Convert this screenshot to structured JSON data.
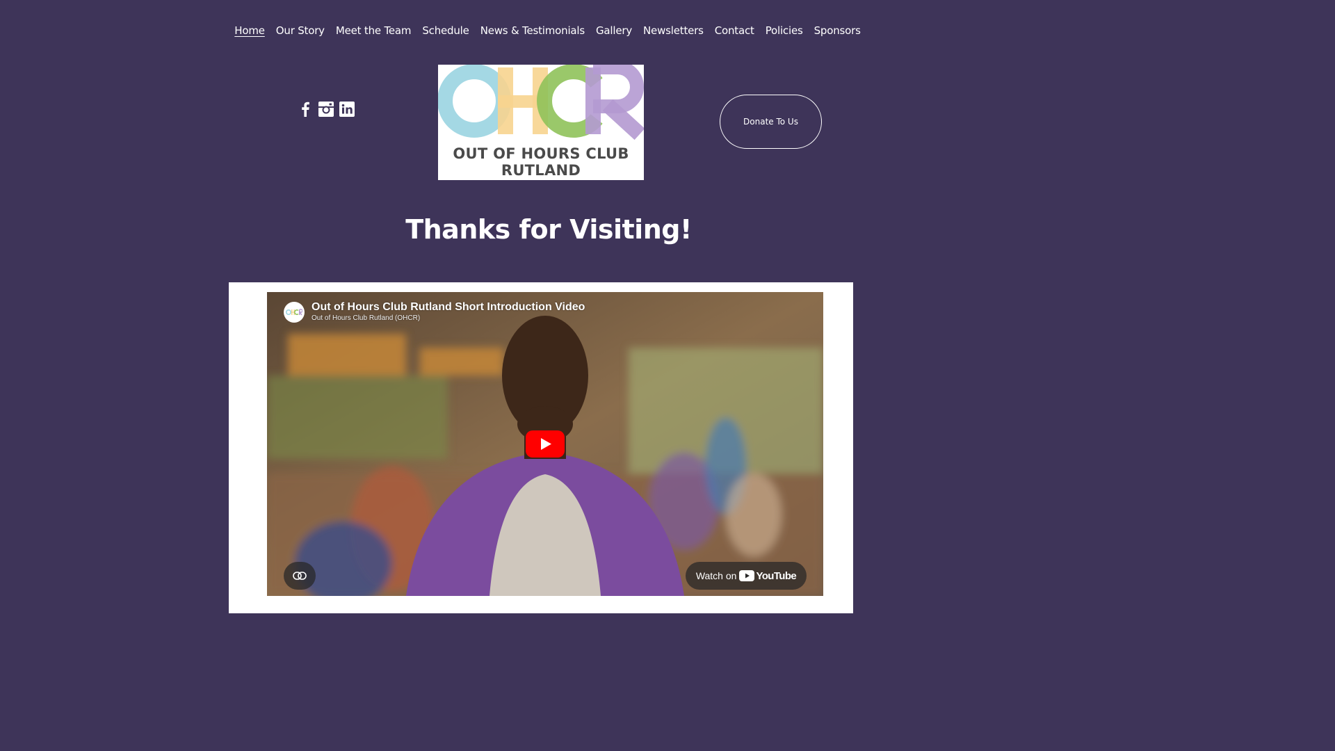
{
  "nav": {
    "items": [
      {
        "label": "Home",
        "active": true
      },
      {
        "label": "Our Story"
      },
      {
        "label": "Meet the Team"
      },
      {
        "label": "Schedule"
      },
      {
        "label": "News & Testimonials"
      },
      {
        "label": "Gallery"
      },
      {
        "label": "Newsletters"
      },
      {
        "label": "Contact"
      },
      {
        "label": "Policies"
      },
      {
        "label": "Sponsors"
      }
    ]
  },
  "social": {
    "icons": [
      "facebook-icon",
      "instagram-icon",
      "linkedin-icon"
    ]
  },
  "logo": {
    "letters": "OHCR",
    "line1": "OUT OF HOURS CLUB",
    "line2": "RUTLAND"
  },
  "donate": {
    "label": "Donate To Us"
  },
  "heading": "Thanks for Visiting!",
  "video": {
    "title": "Out of Hours Club Rutland Short Introduction Video",
    "channel": "Out of Hours Club Rutland (OHCR)",
    "watch_label": "Watch on",
    "youtube_label": "YouTube"
  },
  "colors": {
    "background": "#3e3459",
    "logo_o": "#9fd6e3",
    "logo_h": "#f7d48f",
    "logo_c": "#8fc25a",
    "logo_r": "#b49ad1",
    "youtube_red": "#ff0000"
  }
}
